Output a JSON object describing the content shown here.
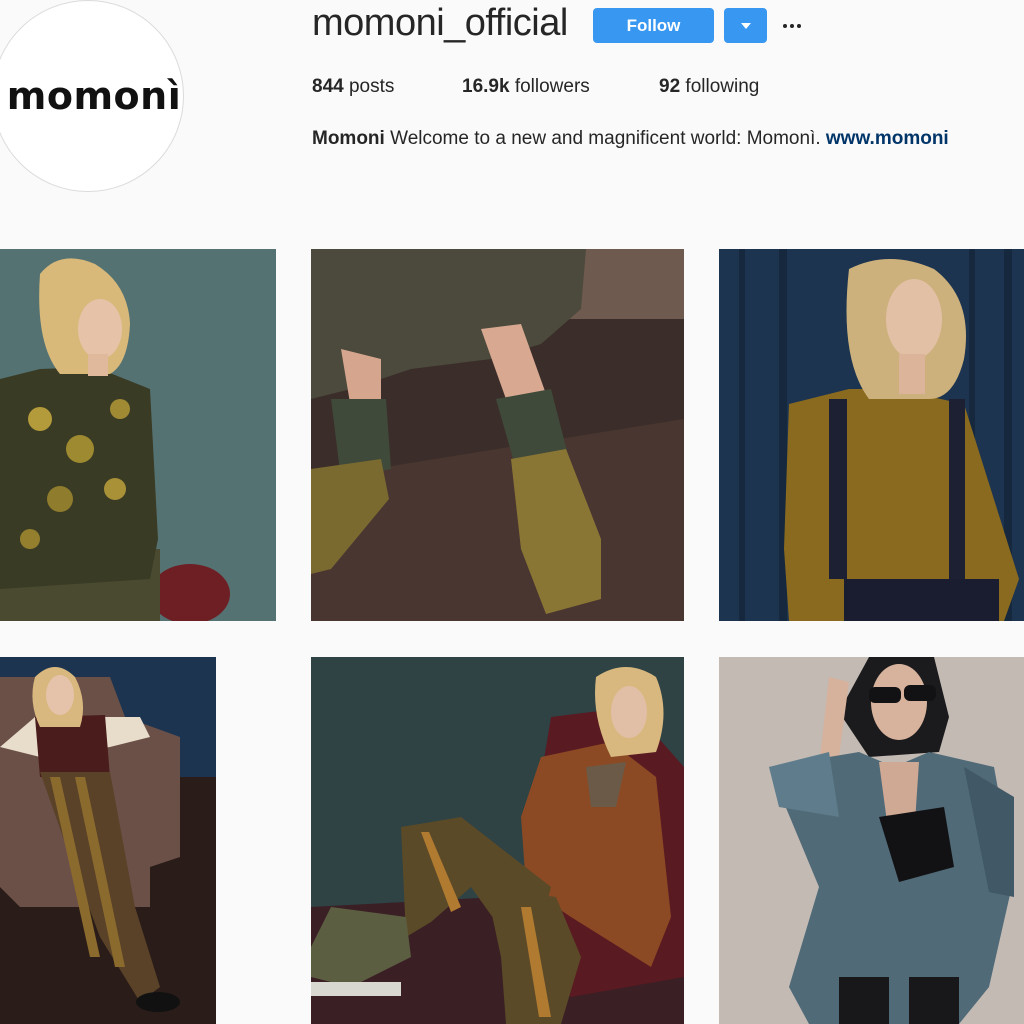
{
  "profile": {
    "avatar_logo_text": "momonì",
    "username": "momoni_official",
    "follow_label": "Follow",
    "posts_count": "844",
    "posts_label": " posts",
    "followers_count": "16.9k",
    "followers_label": " followers",
    "following_count": "92",
    "following_label": " following",
    "bio_name": "Momoni",
    "bio_text": " Welcome to a new and magnificent world: Momonì. ",
    "bio_link": "www.momoni",
    "accent_color": "#3897f0",
    "link_color": "#003569"
  },
  "icons": {
    "dropdown": "caret-down-icon",
    "more": "ellipsis-icon"
  },
  "posts": [
    {
      "subject": "blonde woman in floral print shirt"
    },
    {
      "subject": "legs with velvet shoes and patterned socks"
    },
    {
      "subject": "blonde woman in mustard blouse with suspenders"
    },
    {
      "subject": "woman seated in armchair with striped trousers"
    },
    {
      "subject": "woman reclining in brown jacket and striped trousers"
    },
    {
      "subject": "woman in sunglasses wearing velvet blazer"
    }
  ]
}
